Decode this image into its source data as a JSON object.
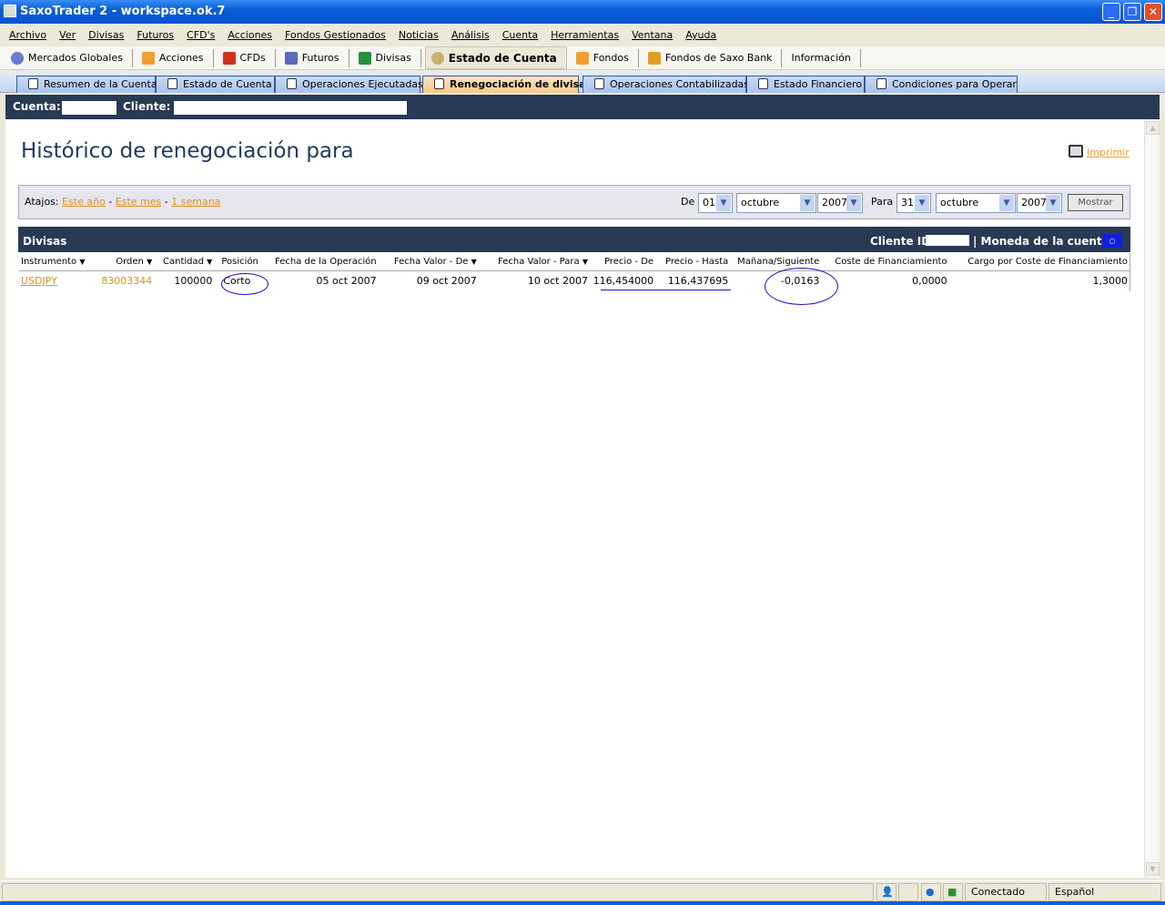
{
  "window": {
    "title": "SaxoTrader 2 - workspace.ok.7"
  },
  "menu": [
    "Archivo",
    "Ver",
    "Divisas",
    "Futuros",
    "CFD's",
    "Acciones",
    "Fondos Gestionados",
    "Noticias",
    "Análisis",
    "Cuenta",
    "Herramientas",
    "Ventana",
    "Ayuda"
  ],
  "toolbar": [
    "Mercados Globales",
    "Acciones",
    "CFDs",
    "Futuros",
    "Divisas",
    "Estado de Cuenta",
    "Fondos",
    "Fondos de Saxo Bank",
    "Información"
  ],
  "tabs": [
    "Resumen de la Cuenta",
    "Estado de Cuenta",
    "Operaciones Ejecutadas",
    "Renegociación de divisas",
    "Operaciones Contabilizadas",
    "Estado Financiero",
    "Condiciones para Operar"
  ],
  "account": {
    "cuenta_label": "Cuenta:",
    "cliente_label": "Cliente:"
  },
  "page": {
    "title": "Histórico de renegociación para",
    "print": "Imprimir"
  },
  "filter": {
    "atajos": "Atajos:",
    "shortcuts": [
      "Este año",
      "Este mes",
      "1 semana"
    ],
    "sep": "-",
    "de": "De",
    "para": "Para",
    "from": {
      "day": "01",
      "month": "octubre",
      "year": "2007"
    },
    "to": {
      "day": "31",
      "month": "octubre",
      "year": "2007"
    },
    "mostrar": "Mostrar"
  },
  "table": {
    "section": "Divisas",
    "cliente_id": "Cliente ID:",
    "moneda": "| Moneda de la cuenta :",
    "columns": [
      "Instrumento",
      "Orden",
      "Cantidad",
      "Posición",
      "Fecha de la Operación",
      "Fecha Valor - De",
      "Fecha Valor - Para",
      "Precio - De",
      "Precio - Hasta",
      "Mañana/Siguiente",
      "Coste de Financiamiento",
      "Cargo por Coste de Financiamiento"
    ],
    "rows": [
      [
        "USDJPY",
        "83003344",
        "100000",
        "Corto",
        "05 oct 2007",
        "09 oct 2007",
        "10 oct 2007",
        "116,454000",
        "116,437695",
        "-0,0163",
        "0,0000",
        "1,3000"
      ]
    ]
  },
  "status": {
    "connection": "Conectado",
    "language": "Español"
  },
  "colors": {
    "accent": "#283a54",
    "link": "#e0901a"
  }
}
